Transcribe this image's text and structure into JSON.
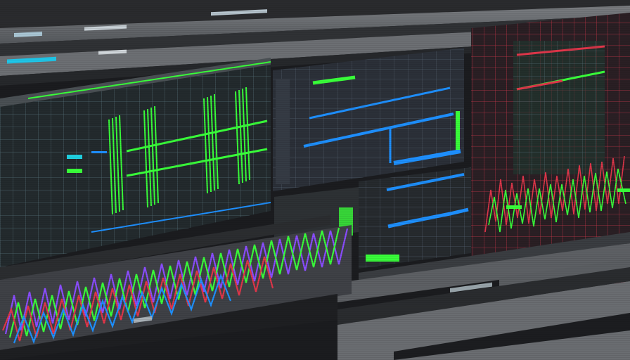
{
  "app": {
    "description_free": true
  },
  "panels": [
    {
      "id": "left-timeline",
      "kind": "green-bars"
    },
    {
      "id": "center-top",
      "kind": "blue-lines"
    },
    {
      "id": "center-bottom",
      "kind": "blue-waves"
    },
    {
      "id": "right-grid",
      "kind": "red-grid"
    },
    {
      "id": "bottom-waveform",
      "kind": "multicolor-wave"
    },
    {
      "id": "bottom-right",
      "kind": "red-graph"
    }
  ],
  "colors": {
    "background": "#1b1c1f",
    "panel_dark": "#222427",
    "grid_line": "#5a6a70",
    "green_accent": "#39ff3a",
    "blue_accent": "#1e90ff",
    "red_accent": "#e0364a",
    "purple_accent": "#8a4dff",
    "gray_band": "#6b6e72"
  }
}
